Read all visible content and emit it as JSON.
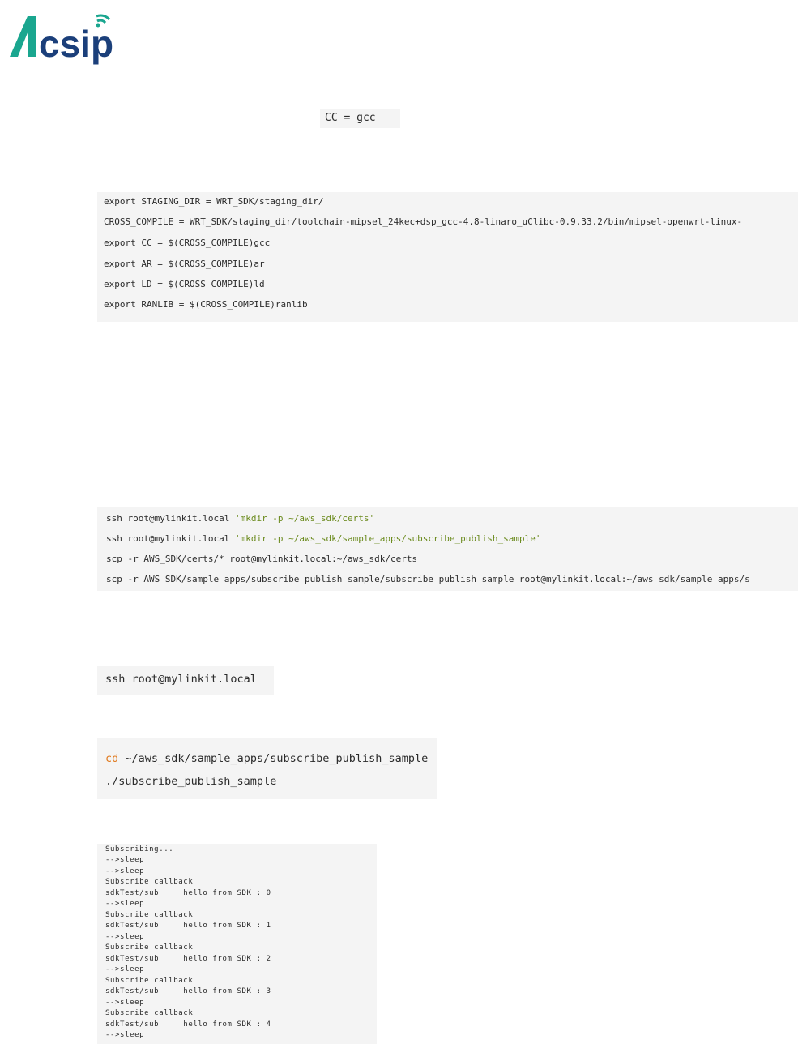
{
  "logo": {
    "text_a": "A",
    "text_rest": "csip",
    "brand_colors": {
      "teal": "#1aa68f",
      "navy": "#1b3f7a"
    }
  },
  "block_cc": {
    "line": "CC = gcc"
  },
  "block_export": {
    "lines": [
      "export STAGING_DIR = WRT_SDK/staging_dir/",
      "CROSS_COMPILE = WRT_SDK/staging_dir/toolchain-mipsel_24kec+dsp_gcc-4.8-linaro_uClibc-0.9.33.2/bin/mipsel-openwrt-linux-",
      "export CC = $(CROSS_COMPILE)gcc",
      "export AR = $(CROSS_COMPILE)ar",
      "export LD = $(CROSS_COMPILE)ld",
      "export RANLIB = $(CROSS_COMPILE)ranlib"
    ]
  },
  "block_scp": {
    "line1_cmd": "ssh root@mylinkit.local ",
    "line1_str": "'mkdir -p ~/aws_sdk/certs'",
    "line2_cmd": "ssh root@mylinkit.local ",
    "line2_str": "'mkdir -p ~/aws_sdk/sample_apps/subscribe_publish_sample'",
    "line3": "scp -r AWS_SDK/certs/* root@mylinkit.local:~/aws_sdk/certs",
    "line4": "scp -r AWS_SDK/sample_apps/subscribe_publish_sample/subscribe_publish_sample root@mylinkit.local:~/aws_sdk/sample_apps/s"
  },
  "block_ssh": {
    "line": "ssh root@mylinkit.local"
  },
  "block_run": {
    "kw": "cd",
    "line1_rest": " ~/aws_sdk/sample_apps/subscribe_publish_sample",
    "line2": "./subscribe_publish_sample"
  },
  "block_output": {
    "lines": [
      "Subscribing...",
      "-->sleep",
      "-->sleep",
      "Subscribe callback",
      "sdkTest/sub     hello from SDK : 0",
      "-->sleep",
      "Subscribe callback",
      "sdkTest/sub     hello from SDK : 1",
      "-->sleep",
      "Subscribe callback",
      "sdkTest/sub     hello from SDK : 2",
      "-->sleep",
      "Subscribe callback",
      "sdkTest/sub     hello from SDK : 3",
      "-->sleep",
      "Subscribe callback",
      "sdkTest/sub     hello from SDK : 4",
      "-->sleep"
    ]
  }
}
